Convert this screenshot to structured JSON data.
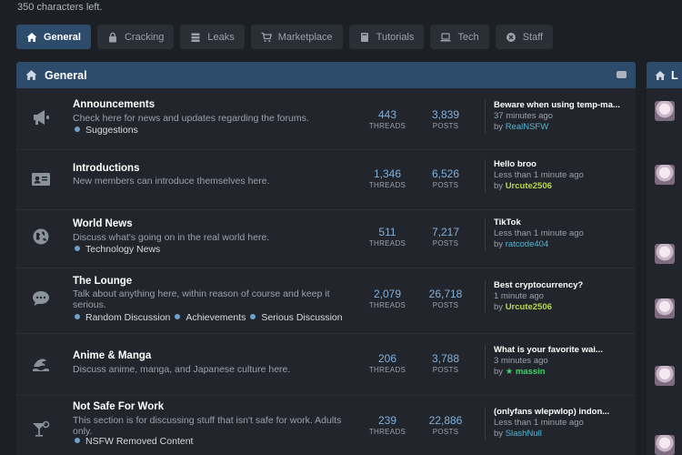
{
  "chars_left": "350 characters left.",
  "tabs": [
    {
      "label": "General",
      "icon": "home-icon",
      "active": true
    },
    {
      "label": "Cracking",
      "icon": "lock-icon"
    },
    {
      "label": "Leaks",
      "icon": "layers-icon"
    },
    {
      "label": "Marketplace",
      "icon": "cart-icon"
    },
    {
      "label": "Tutorials",
      "icon": "book-icon"
    },
    {
      "label": "Tech",
      "icon": "laptop-icon"
    },
    {
      "label": "Staff",
      "icon": "shield-x-icon"
    }
  ],
  "panel": {
    "title": "General"
  },
  "sidebar": {
    "title": "L"
  },
  "stat_labels": {
    "threads": "THREADS",
    "posts": "POSTS"
  },
  "forums": [
    {
      "title": "Announcements",
      "desc": "Check here for news and updates regarding the forums.",
      "subs": [
        "Suggestions"
      ],
      "threads": "443",
      "posts": "3,839",
      "last_title": "Beware when using temp-ma...",
      "last_when": "37 minutes ago",
      "by": "by",
      "last_user": "RealNSFW",
      "user_color": "#4fb7d6"
    },
    {
      "title": "Introductions",
      "desc": "New members can introduce themselves here.",
      "subs": [],
      "threads": "1,346",
      "posts": "6,526",
      "last_title": "Hello broo",
      "last_when": "Less than 1 minute ago",
      "by": "by",
      "last_user": "Urcute2506",
      "user_color": "#b7d84a"
    },
    {
      "title": "World News",
      "desc": "Discuss what's going on in the real world here.",
      "subs": [
        "Technology News"
      ],
      "threads": "511",
      "posts": "7,217",
      "last_title": "TikTok",
      "last_when": "Less than 1 minute ago",
      "by": "by",
      "last_user": "ratcode404",
      "user_color": "#4fb7d6"
    },
    {
      "title": "The Lounge",
      "desc": "Talk about anything here, within reason of course and keep it serious.",
      "subs": [
        "Random Discussion",
        "Achievements",
        "Serious Discussion"
      ],
      "threads": "2,079",
      "posts": "26,718",
      "last_title": "Best cryptocurrency?",
      "last_when": "1 minute ago",
      "by": "by",
      "last_user": "Urcute2506",
      "user_color": "#b7d84a"
    },
    {
      "title": "Anime & Manga",
      "desc": "Discuss anime, manga, and Japanese culture here.",
      "subs": [],
      "threads": "206",
      "posts": "3,788",
      "last_title": "What is your favorite wai...",
      "last_when": "3 minutes ago",
      "by": "by",
      "last_user": "★ massin",
      "user_color": "#3fd36a"
    },
    {
      "title": "Not Safe For Work",
      "desc": "This section is for discussing stuff that isn't safe for work. Adults only.",
      "subs": [
        "NSFW Removed Content"
      ],
      "threads": "239",
      "posts": "22,886",
      "last_title": "(onlyfans wlepwlop) indon...",
      "last_when": "Less than 1 minute ago",
      "by": "by",
      "last_user": "SlashNull",
      "user_color": "#4fb7d6"
    }
  ]
}
